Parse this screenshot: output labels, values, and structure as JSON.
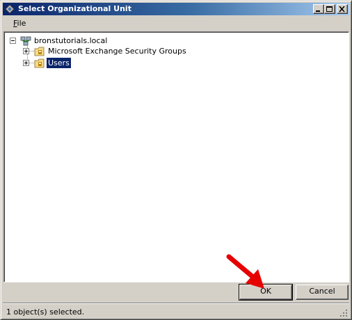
{
  "window": {
    "title": "Select Organizational Unit"
  },
  "menu": {
    "items": [
      {
        "label_accel": "F",
        "label_rest": "ile"
      }
    ]
  },
  "tree": {
    "root": {
      "label": "bronstutorials.local",
      "expanded": true
    },
    "children": [
      {
        "label": "Microsoft Exchange Security Groups",
        "selected": false
      },
      {
        "label": "Users",
        "selected": true
      }
    ]
  },
  "buttons": {
    "ok": "OK",
    "cancel": "Cancel"
  },
  "status": {
    "text": "1 object(s) selected."
  },
  "colors": {
    "selection": "#0a246a",
    "annotation_arrow": "#e60000"
  },
  "icons": {
    "app": "dialog-app-icon",
    "domain": "domain-icon",
    "ou": "organizational-unit-folder-icon",
    "annotation": "red-pointer-arrow"
  }
}
